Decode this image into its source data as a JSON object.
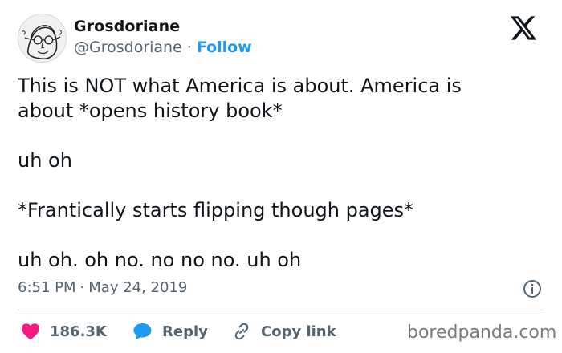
{
  "author": {
    "name": "Grosdoriane",
    "handle": "@Grosdoriane",
    "separator": "·",
    "follow_label": "Follow",
    "avatar_icon": "sketch-portrait-avatar"
  },
  "platform_icon": "x-logo-icon",
  "tweet": {
    "line1": "This is NOT what America is about. America is",
    "line2": "about *opens history book*",
    "line3": "uh oh",
    "line4": "*Frantically starts flipping though pages*",
    "line5": "uh oh. oh no. no no no. uh oh"
  },
  "meta": {
    "time": "6:51 PM",
    "separator": "·",
    "date": "May 24, 2019",
    "info_icon": "info-icon"
  },
  "actions": {
    "likes": "186.3K",
    "reply_label": "Reply",
    "copy_link_label": "Copy link"
  },
  "watermark": "boredpanda.com",
  "colors": {
    "accent": "#1d9bf0",
    "heart": "#f91880",
    "text": "#0f1419",
    "muted": "#536471"
  }
}
